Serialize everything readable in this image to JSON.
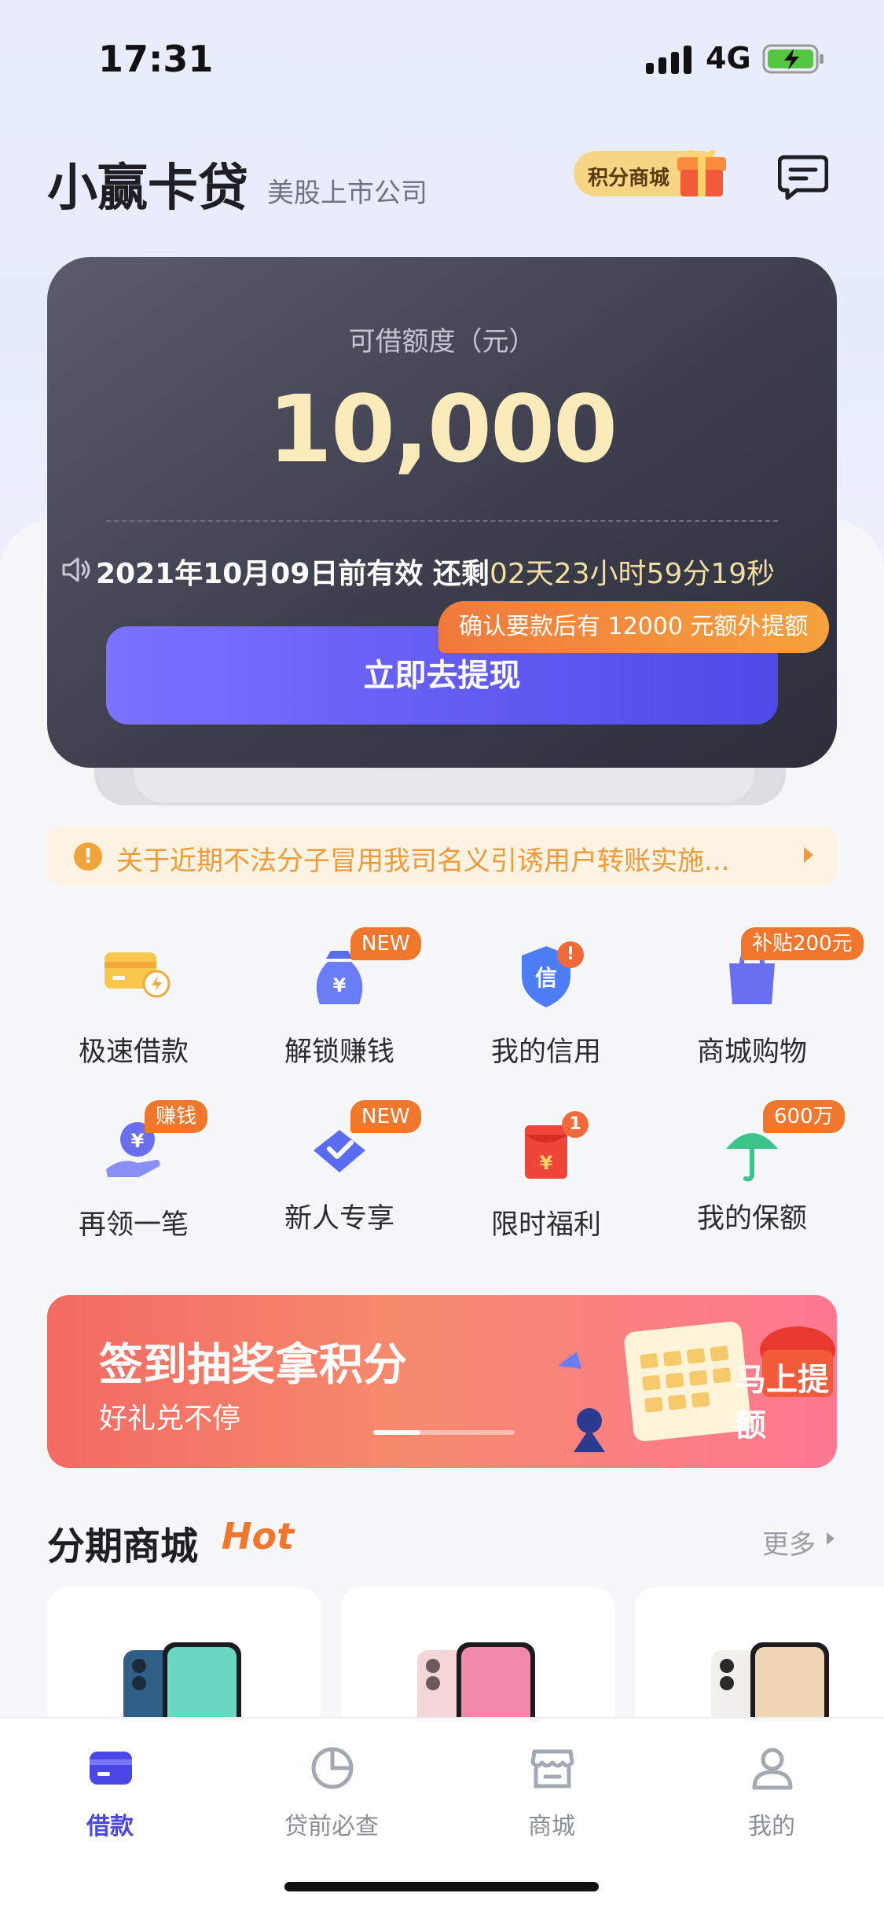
{
  "status_bar": {
    "time": "17:31",
    "network": "4G"
  },
  "header": {
    "brand": "小赢卡贷",
    "subtitle": "美股上市公司",
    "points_mall": "积分商城"
  },
  "credit_card": {
    "label": "可借额度（元）",
    "amount": "10,000",
    "valid_text": "2021年10月09日前有效 还剩",
    "countdown": "02天23小时59分19秒",
    "extra_tip": "确认要款后有 12000 元额外提额",
    "withdraw_button": "立即去提现"
  },
  "notice": {
    "text": "关于近期不法分子冒用我司名义引诱用户转账实施..."
  },
  "features": [
    {
      "label": "极速借款",
      "icon": "fast-loan-icon"
    },
    {
      "label": "解锁赚钱",
      "icon": "money-bag-icon",
      "badge": "NEW"
    },
    {
      "label": "我的信用",
      "icon": "credit-shield-icon",
      "badge": "!"
    },
    {
      "label": "商城购物",
      "icon": "shopping-bag-icon",
      "badge": "补贴200元"
    },
    {
      "label": "再领一笔",
      "icon": "hand-coin-icon",
      "badge": "赚钱"
    },
    {
      "label": "新人专享",
      "icon": "newcomer-ticket-icon",
      "badge": "NEW"
    },
    {
      "label": "限时福利",
      "icon": "red-envelope-icon",
      "badge": "1"
    },
    {
      "label": "我的保额",
      "icon": "umbrella-icon",
      "badge": "600万"
    }
  ],
  "banner": {
    "title": "签到抽奖拿积分",
    "subtitle": "好礼兑不停",
    "action": "马上提额"
  },
  "mall": {
    "title": "分期商城",
    "hot": "Hot",
    "more": "更多"
  },
  "tabbar": [
    {
      "label": "借款",
      "active": true
    },
    {
      "label": "贷前必查",
      "active": false
    },
    {
      "label": "商城",
      "active": false
    },
    {
      "label": "我的",
      "active": false
    }
  ],
  "colors": {
    "accent": "#4a47e6",
    "orange": "#f0772c",
    "gold": "#fbeaba"
  }
}
